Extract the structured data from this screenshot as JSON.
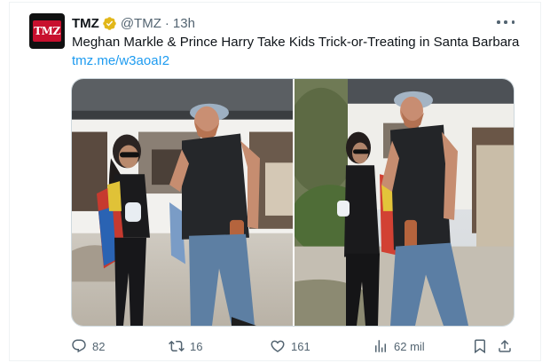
{
  "tweet": {
    "author_name": "TMZ",
    "avatar_text": "TMZ",
    "handle": "@TMZ",
    "separator": "·",
    "time": "13h",
    "text": "Meghan Markle & Prince Harry Take Kids Trick-or-Treating in Santa Barbara",
    "link": "tmz.me/w3aoaI2"
  },
  "media": {
    "photos": [
      {
        "icon": "photo-left"
      },
      {
        "icon": "photo-right"
      }
    ]
  },
  "actions": {
    "replies": "82",
    "reposts": "16",
    "likes": "161",
    "views": "62 mil"
  },
  "colors": {
    "accent": "#1d9bf0",
    "verified_gold": "#e2b719",
    "muted": "#536471",
    "tmz_red": "#c8102e"
  }
}
